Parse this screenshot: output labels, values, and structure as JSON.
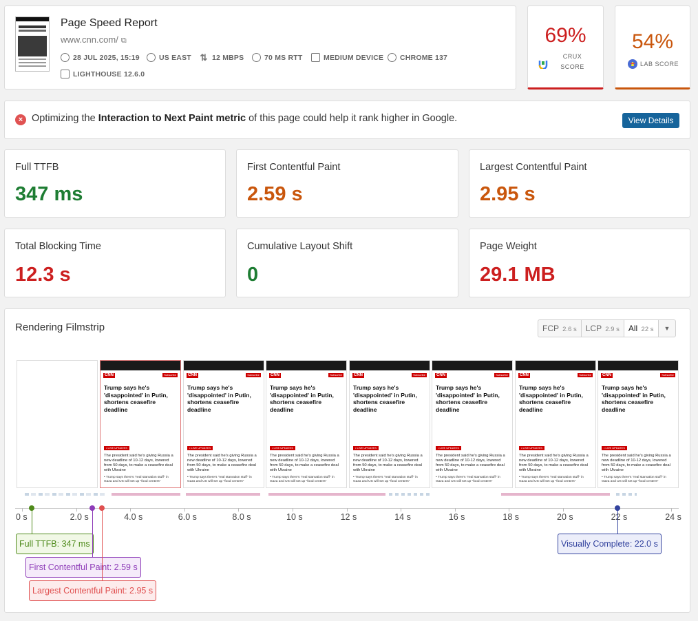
{
  "header": {
    "title": "Page Speed Report",
    "url": "www.cnn.com/",
    "meta": {
      "date": "28 JUL 2025, 15:19",
      "region": "US EAST",
      "bandwidth": "12 MBPS",
      "rtt": "70 MS RTT",
      "device": "MEDIUM DEVICE",
      "browser": "CHROME 137",
      "lighthouse": "LIGHTHOUSE 12.6.0"
    }
  },
  "scores": {
    "crux": {
      "value": "69%",
      "label_line1": "CRUX",
      "label_line2": "SCORE",
      "color": "#cc1f1f"
    },
    "lab": {
      "value": "54%",
      "label": "LAB SCORE",
      "color": "#c9560c"
    }
  },
  "alert": {
    "prefix": "Optimizing the ",
    "metric": "Interaction to Next Paint metric",
    "suffix": " of this page could help it rank higher in Google.",
    "button": "View Details"
  },
  "metrics": [
    {
      "label": "Full TTFB",
      "value": "347 ms",
      "color": "#1e7d33"
    },
    {
      "label": "First Contentful Paint",
      "value": "2.59 s",
      "color": "#c9560c"
    },
    {
      "label": "Largest Contentful Paint",
      "value": "2.95 s",
      "color": "#c9560c"
    },
    {
      "label": "Total Blocking Time",
      "value": "12.3 s",
      "color": "#cc1f1f"
    },
    {
      "label": "Cumulative Layout Shift",
      "value": "0",
      "color": "#1e7d33"
    },
    {
      "label": "Page Weight",
      "value": "29.1 MB",
      "color": "#cc1f1f"
    }
  ],
  "filmstrip": {
    "title": "Rendering Filmstrip",
    "segments": [
      {
        "label": "FCP",
        "time": "2.6 s"
      },
      {
        "label": "LCP",
        "time": "2.9 s"
      },
      {
        "label": "All",
        "time": "22 s"
      }
    ],
    "dropdown_icon": "chevron-down-icon",
    "frame": {
      "logo": "CNN",
      "subscribe": "Subscribe",
      "headline": "Trump says he's 'disappointed' in Putin, shortens ceasefire deadline",
      "live": "• LIVE UPDATES",
      "body": "The president said he's giving Russia a new deadline of 10-12 days, lowered from 50 days, to make a ceasefire deal with Ukraine",
      "bullet": "• Trump says there's \"real starvation stuff\" in Gaza and US will set up \"food centers\""
    },
    "axis_ticks": [
      "0 s",
      "2.0 s",
      "4.0 s",
      "6.0 s",
      "8.0 s",
      "10 s",
      "12 s",
      "14 s",
      "16 s",
      "18 s",
      "20 s",
      "22 s",
      "24 s"
    ],
    "markers": {
      "ttfb": {
        "label": "Full TTFB: 347 ms",
        "time_s": 0.347,
        "color": "#4e8a1a"
      },
      "fcp": {
        "label": "First Contentful Paint: 2.59 s",
        "time_s": 2.59,
        "color": "#8e3cb8"
      },
      "lcp": {
        "label": "Largest Contentful Paint: 2.95 s",
        "time_s": 2.95,
        "color": "#e05050"
      },
      "vc": {
        "label": "Visually Complete: 22.0 s",
        "time_s": 22.0,
        "color": "#33439e"
      }
    }
  }
}
